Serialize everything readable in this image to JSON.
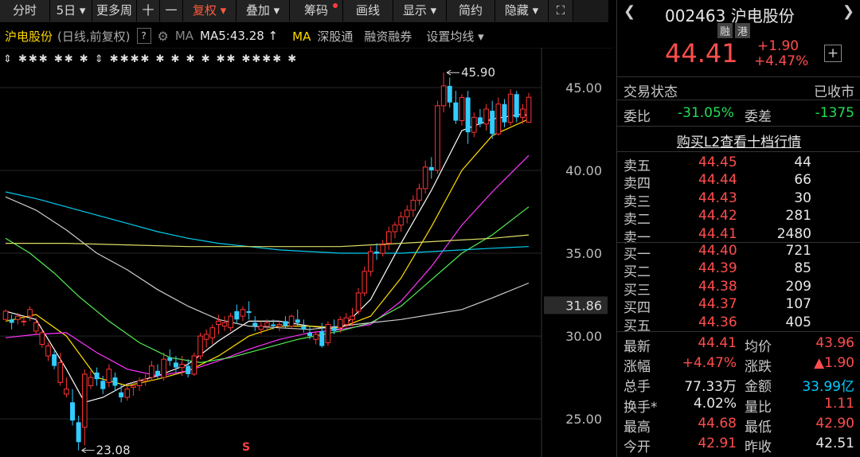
{
  "toolbar": {
    "items": [
      {
        "label": "分时"
      },
      {
        "label": "5日 ▾"
      },
      {
        "label": "更多周"
      },
      {
        "label": "十"
      },
      {
        "label": "一"
      },
      {
        "label": "复权 ▾"
      },
      {
        "label": "叠加 ▾"
      },
      {
        "label": "筹码"
      },
      {
        "label": "画线"
      },
      {
        "label": "显示 ▾"
      },
      {
        "label": "简约"
      },
      {
        "label": "隐藏 ▾"
      },
      {
        "label": "⛶"
      }
    ],
    "active_index": 5,
    "dot_index": 7
  },
  "info": {
    "name": "沪电股份",
    "mode": "(日线,前复权)",
    "help": "?",
    "ma_label": "MA",
    "ma5": "MA5:43.28 ↑",
    "ma_prefix": "MA",
    "link1": "深股通",
    "link2": "融资融券",
    "link3": "设置均线 ▾"
  },
  "chart_data": {
    "type": "candlestick",
    "y_ticks": [
      "45.00",
      "40.00",
      "35.00",
      "30.00",
      "25.00"
    ],
    "current_price_label": "31.86",
    "high_annotation": "45.90",
    "low_annotation": "23.08",
    "ylim": [
      22.7,
      47.4
    ],
    "candles": [
      [
        31.0,
        31.6,
        31.2,
        31.5
      ],
      [
        31.0,
        31.3,
        30.4,
        30.8
      ],
      [
        31.0,
        31.4,
        30.7,
        31.2
      ],
      [
        30.9,
        31.2,
        30.6,
        30.9
      ],
      [
        31.2,
        31.8,
        30.9,
        31.6
      ],
      [
        30.3,
        31.1,
        30.1,
        30.8
      ],
      [
        29.5,
        30.4,
        29.3,
        30.2
      ],
      [
        28.8,
        29.6,
        28.5,
        29.4
      ],
      [
        28.9,
        29.1,
        28.0,
        28.2
      ],
      [
        27.2,
        29.0,
        27.0,
        28.4
      ],
      [
        26.5,
        27.5,
        26.3,
        26.8
      ],
      [
        26.0,
        26.8,
        24.6,
        24.9
      ],
      [
        24.8,
        25.2,
        23.1,
        23.6
      ],
      [
        24.5,
        28.0,
        23.4,
        27.7
      ],
      [
        27.0,
        27.9,
        26.8,
        27.5
      ],
      [
        27.8,
        28.1,
        27.0,
        27.4
      ],
      [
        27.3,
        27.6,
        26.5,
        26.8
      ],
      [
        27.2,
        28.3,
        26.9,
        28.0
      ],
      [
        27.5,
        27.8,
        26.7,
        27.0
      ],
      [
        26.6,
        27.1,
        26.0,
        26.3
      ],
      [
        26.3,
        27.0,
        26.1,
        26.8
      ],
      [
        26.9,
        27.3,
        26.4,
        27.0
      ],
      [
        27.0,
        27.5,
        26.7,
        27.3
      ],
      [
        27.3,
        27.7,
        27.0,
        27.4
      ],
      [
        27.5,
        28.5,
        27.3,
        28.2
      ],
      [
        27.9,
        28.3,
        27.4,
        27.6
      ],
      [
        27.5,
        29.0,
        27.3,
        28.6
      ],
      [
        28.7,
        29.2,
        28.2,
        28.5
      ],
      [
        28.4,
        28.8,
        27.8,
        28.1
      ],
      [
        28.1,
        28.8,
        27.6,
        28.3
      ],
      [
        28.2,
        28.6,
        27.5,
        27.7
      ],
      [
        27.7,
        29.0,
        27.6,
        28.8
      ],
      [
        28.8,
        30.2,
        28.6,
        30.0
      ],
      [
        29.8,
        30.4,
        29.3,
        30.1
      ],
      [
        29.9,
        30.7,
        29.5,
        30.5
      ],
      [
        30.7,
        31.3,
        30.1,
        30.9
      ],
      [
        30.6,
        31.2,
        30.3,
        30.8
      ],
      [
        30.5,
        31.4,
        30.3,
        31.2
      ],
      [
        31.5,
        31.9,
        30.8,
        31.0
      ],
      [
        31.2,
        31.8,
        30.9,
        31.6
      ],
      [
        31.5,
        32.1,
        31.0,
        31.4
      ],
      [
        30.8,
        31.2,
        30.3,
        30.6
      ],
      [
        30.4,
        30.9,
        30.1,
        30.6
      ],
      [
        30.6,
        31.0,
        30.3,
        30.8
      ],
      [
        30.7,
        31.0,
        30.4,
        30.6
      ],
      [
        30.6,
        30.9,
        30.3,
        30.7
      ],
      [
        30.9,
        31.2,
        30.5,
        30.6
      ],
      [
        30.6,
        31.3,
        30.4,
        31.2
      ],
      [
        31.0,
        31.6,
        30.6,
        30.8
      ],
      [
        30.6,
        31.0,
        30.2,
        30.4
      ],
      [
        30.2,
        30.6,
        29.8,
        30.0
      ],
      [
        29.8,
        30.3,
        29.5,
        30.1
      ],
      [
        30.3,
        30.8,
        29.3,
        29.4
      ],
      [
        29.6,
        30.9,
        29.4,
        30.7
      ],
      [
        30.5,
        31.0,
        30.1,
        30.3
      ],
      [
        30.5,
        31.2,
        30.2,
        31.0
      ],
      [
        30.7,
        31.4,
        30.5,
        31.1
      ],
      [
        31.0,
        31.7,
        30.6,
        31.2
      ],
      [
        31.5,
        32.9,
        31.3,
        32.6
      ],
      [
        32.6,
        34.2,
        32.4,
        33.9
      ],
      [
        33.9,
        35.4,
        33.6,
        35.1
      ],
      [
        35.1,
        35.6,
        34.6,
        35.0
      ],
      [
        35.0,
        35.8,
        34.8,
        35.5
      ],
      [
        35.6,
        36.6,
        35.2,
        36.3
      ],
      [
        36.3,
        36.9,
        35.9,
        36.7
      ],
      [
        36.7,
        37.5,
        36.3,
        37.2
      ],
      [
        37.2,
        37.9,
        36.8,
        37.6
      ],
      [
        37.6,
        38.5,
        37.2,
        38.2
      ],
      [
        38.2,
        39.2,
        37.9,
        38.9
      ],
      [
        38.9,
        40.6,
        38.6,
        40.2
      ],
      [
        40.2,
        40.8,
        39.5,
        40.0
      ],
      [
        40.0,
        44.2,
        39.8,
        43.9
      ],
      [
        43.9,
        45.9,
        43.5,
        45.1
      ],
      [
        45.1,
        45.6,
        43.8,
        44.1
      ],
      [
        44.1,
        44.8,
        42.8,
        43.0
      ],
      [
        43.0,
        44.6,
        42.7,
        44.4
      ],
      [
        44.4,
        44.8,
        41.6,
        42.3
      ],
      [
        42.3,
        43.5,
        42.0,
        43.2
      ],
      [
        43.2,
        43.7,
        42.6,
        42.8
      ],
      [
        42.8,
        44.0,
        42.4,
        43.7
      ],
      [
        43.6,
        44.2,
        41.9,
        42.2
      ],
      [
        42.2,
        44.4,
        42.1,
        44.0
      ],
      [
        44.0,
        44.3,
        42.6,
        42.9
      ],
      [
        42.9,
        44.9,
        42.7,
        44.6
      ],
      [
        44.6,
        44.8,
        42.9,
        43.2
      ],
      [
        43.2,
        44.0,
        42.8,
        43.7
      ],
      [
        42.91,
        44.68,
        42.9,
        44.41
      ]
    ],
    "ma_series": [
      {
        "color": "#ffffff",
        "points": [
          [
            0,
            31.5
          ],
          [
            5,
            31.0
          ],
          [
            10,
            28.0
          ],
          [
            13,
            26.0
          ],
          [
            16,
            26.3
          ],
          [
            20,
            27.1
          ],
          [
            25,
            27.6
          ],
          [
            30,
            28.3
          ],
          [
            35,
            29.7
          ],
          [
            40,
            30.9
          ],
          [
            45,
            30.9
          ],
          [
            50,
            30.6
          ],
          [
            55,
            30.4
          ],
          [
            60,
            32.2
          ],
          [
            65,
            35.6
          ],
          [
            70,
            38.8
          ],
          [
            75,
            42.4
          ],
          [
            80,
            43.1
          ],
          [
            85,
            43.4
          ],
          [
            86,
            43.28
          ]
        ]
      },
      {
        "color": "#ffdd00",
        "points": [
          [
            0,
            30.9
          ],
          [
            5,
            31.3
          ],
          [
            10,
            30.0
          ],
          [
            15,
            27.5
          ],
          [
            20,
            27.0
          ],
          [
            25,
            27.4
          ],
          [
            30,
            27.9
          ],
          [
            35,
            28.8
          ],
          [
            40,
            30.0
          ],
          [
            45,
            30.6
          ],
          [
            50,
            30.6
          ],
          [
            55,
            30.5
          ],
          [
            60,
            31.2
          ],
          [
            65,
            33.5
          ],
          [
            70,
            36.6
          ],
          [
            75,
            40.0
          ],
          [
            80,
            42.1
          ],
          [
            86,
            43.1
          ]
        ]
      },
      {
        "color": "#ff33ff",
        "points": [
          [
            0,
            29.9
          ],
          [
            5,
            30.1
          ],
          [
            10,
            30.2
          ],
          [
            15,
            29.0
          ],
          [
            20,
            28.0
          ],
          [
            25,
            27.6
          ],
          [
            30,
            27.9
          ],
          [
            35,
            28.5
          ],
          [
            40,
            29.2
          ],
          [
            45,
            29.8
          ],
          [
            50,
            30.2
          ],
          [
            55,
            30.4
          ],
          [
            60,
            30.7
          ],
          [
            65,
            32.1
          ],
          [
            70,
            34.2
          ],
          [
            75,
            36.7
          ],
          [
            80,
            38.7
          ],
          [
            86,
            40.9
          ]
        ]
      },
      {
        "color": "#55ee55",
        "points": [
          [
            0,
            35.9
          ],
          [
            4,
            35.0
          ],
          [
            8,
            33.8
          ],
          [
            12,
            32.4
          ],
          [
            17,
            30.9
          ],
          [
            22,
            29.6
          ],
          [
            27,
            28.7
          ],
          [
            32,
            28.4
          ],
          [
            37,
            28.7
          ],
          [
            42,
            29.2
          ],
          [
            48,
            29.8
          ],
          [
            55,
            30.3
          ],
          [
            60,
            30.8
          ],
          [
            65,
            31.8
          ],
          [
            70,
            33.4
          ],
          [
            75,
            35.0
          ],
          [
            80,
            36.1
          ],
          [
            86,
            37.8
          ]
        ]
      },
      {
        "color": "#cccccc",
        "points": [
          [
            0,
            38.4
          ],
          [
            5,
            37.6
          ],
          [
            10,
            36.4
          ],
          [
            15,
            35.0
          ],
          [
            20,
            34.0
          ],
          [
            25,
            32.8
          ],
          [
            30,
            31.8
          ],
          [
            35,
            31.0
          ],
          [
            40,
            30.6
          ],
          [
            45,
            30.5
          ],
          [
            50,
            30.4
          ],
          [
            55,
            30.6
          ],
          [
            60,
            30.8
          ],
          [
            65,
            31.0
          ],
          [
            70,
            31.3
          ],
          [
            75,
            31.6
          ],
          [
            80,
            32.3
          ],
          [
            86,
            33.2
          ]
        ]
      },
      {
        "color": "#00ccee",
        "points": [
          [
            0,
            38.7
          ],
          [
            5,
            38.3
          ],
          [
            10,
            37.8
          ],
          [
            15,
            37.3
          ],
          [
            20,
            36.8
          ],
          [
            25,
            36.3
          ],
          [
            30,
            35.9
          ],
          [
            35,
            35.6
          ],
          [
            40,
            35.4
          ],
          [
            45,
            35.2
          ],
          [
            50,
            35.1
          ],
          [
            55,
            35.0
          ],
          [
            60,
            35.0
          ],
          [
            65,
            35.0
          ],
          [
            70,
            35.1
          ],
          [
            75,
            35.2
          ],
          [
            80,
            35.3
          ],
          [
            86,
            35.4
          ]
        ]
      },
      {
        "color": "#dddd66",
        "points": [
          [
            0,
            35.6
          ],
          [
            10,
            35.6
          ],
          [
            20,
            35.5
          ],
          [
            30,
            35.4
          ],
          [
            40,
            35.4
          ],
          [
            50,
            35.4
          ],
          [
            55,
            35.4
          ],
          [
            60,
            35.5
          ],
          [
            65,
            35.6
          ],
          [
            70,
            35.7
          ],
          [
            75,
            35.8
          ],
          [
            80,
            35.9
          ],
          [
            86,
            36.1
          ]
        ]
      }
    ],
    "event_marks": "⇕ ✱✱✱ ✱✱ ✱ ⇕ ✱✱✱✱ ✱ ✱ ✱ ✱ ✱✱ ✱✱✱✱ ✱"
  },
  "panel": {
    "code_name": "002463 沪电股份",
    "badge1": "融",
    "badge2": "港",
    "price": "44.41",
    "change": "+1.90",
    "change_pct": "+4.47%",
    "plus": "+",
    "trade_state_label": "交易状态",
    "trade_state_value": "已收市",
    "wb_label": "委比",
    "wb_value": "-31.05%",
    "wc_label": "委差",
    "wc_value": "-1375",
    "l2_link": "购买L2查看十档行情",
    "asks": [
      {
        "label": "卖五",
        "price": "44.45",
        "vol": "44"
      },
      {
        "label": "卖四",
        "price": "44.44",
        "vol": "66"
      },
      {
        "label": "卖三",
        "price": "44.43",
        "vol": "30"
      },
      {
        "label": "卖二",
        "price": "44.42",
        "vol": "281"
      },
      {
        "label": "卖一",
        "price": "44.41",
        "vol": "2480"
      }
    ],
    "bids": [
      {
        "label": "买一",
        "price": "44.40",
        "vol": "721"
      },
      {
        "label": "买二",
        "price": "44.39",
        "vol": "85"
      },
      {
        "label": "买三",
        "price": "44.38",
        "vol": "209"
      },
      {
        "label": "买四",
        "price": "44.37",
        "vol": "107"
      },
      {
        "label": "买五",
        "price": "44.36",
        "vol": "405"
      }
    ],
    "stats": [
      {
        "l1": "最新",
        "v1": "44.41",
        "c1": "red",
        "l2": "均价",
        "v2": "43.96",
        "c2": "red"
      },
      {
        "l1": "涨幅",
        "v1": "+4.47%",
        "c1": "red",
        "l2": "涨跌",
        "v2": "▲1.90",
        "c2": "red"
      },
      {
        "l1": "总手",
        "v1": "77.33万",
        "c1": "white",
        "l2": "金额",
        "v2": "33.99亿",
        "c2": "cyan"
      },
      {
        "l1": "换手*",
        "v1": "4.02%",
        "c1": "white",
        "l2": "量比",
        "v2": "1.11",
        "c2": "red"
      },
      {
        "l1": "最高",
        "v1": "44.68",
        "c1": "red",
        "l2": "最低",
        "v2": "42.90",
        "c2": "red"
      },
      {
        "l1": "今开",
        "v1": "42.91",
        "c1": "red",
        "l2": "昨收",
        "v2": "42.51",
        "c2": "white"
      }
    ]
  }
}
